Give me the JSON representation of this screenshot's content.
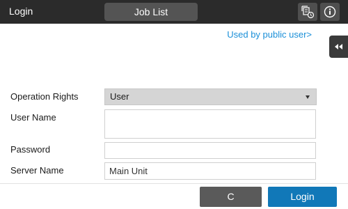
{
  "header": {
    "title": "Login",
    "job_list_label": "Job List",
    "icons": [
      "job-queue-icon",
      "info-icon"
    ]
  },
  "public_user_link": "Used by public user>",
  "side_tab_icon": "double-chevron-left-icon",
  "form": {
    "operation_rights": {
      "label": "Operation Rights",
      "value": "User"
    },
    "user_name": {
      "label": "User Name",
      "value": ""
    },
    "password": {
      "label": "Password",
      "value": ""
    },
    "server_name": {
      "label": "Server Name",
      "value": "Main Unit"
    }
  },
  "footer": {
    "clear_label": "C",
    "login_label": "Login"
  },
  "colors": {
    "top_bar": "#2b2b2b",
    "link": "#1a8fd8",
    "login_button": "#1178b8",
    "clear_button": "#5a5a5a"
  }
}
